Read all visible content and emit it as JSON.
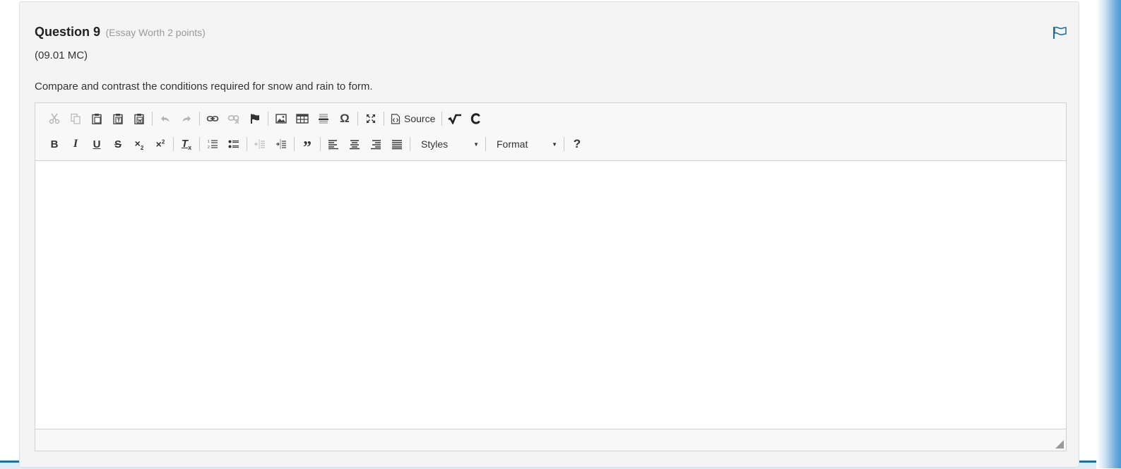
{
  "question": {
    "title": "Question 9",
    "meta": "(Essay Worth 2 points)",
    "code": "(09.01 MC)",
    "prompt": "Compare and contrast the conditions required for snow and rain to form."
  },
  "editor": {
    "source_label": "Source",
    "styles_label": "Styles",
    "format_label": "Format",
    "help_label": "?",
    "answer_text": ""
  },
  "icons": {
    "row1": [
      "cut-icon",
      "copy-icon",
      "paste-icon",
      "paste-text-icon",
      "paste-word-icon",
      "undo-icon",
      "redo-icon",
      "link-icon",
      "unlink-icon",
      "anchor-icon",
      "image-icon",
      "table-icon",
      "horizontal-line-icon",
      "special-char-icon",
      "maximize-icon",
      "source-icon",
      "math-icon",
      "chemistry-icon"
    ],
    "row2": [
      "bold-icon",
      "italic-icon",
      "underline-icon",
      "strikethrough-icon",
      "subscript-icon",
      "superscript-icon",
      "remove-format-icon",
      "numbered-list-icon",
      "bulleted-list-icon",
      "decrease-indent-icon",
      "increase-indent-icon",
      "blockquote-icon",
      "align-left-icon",
      "align-center-icon",
      "align-right-icon",
      "justify-icon"
    ]
  },
  "colors": {
    "accent": "#1f6fa8",
    "card_bg": "#f4f4f4",
    "toolbar_bg": "#f8f8f8"
  }
}
